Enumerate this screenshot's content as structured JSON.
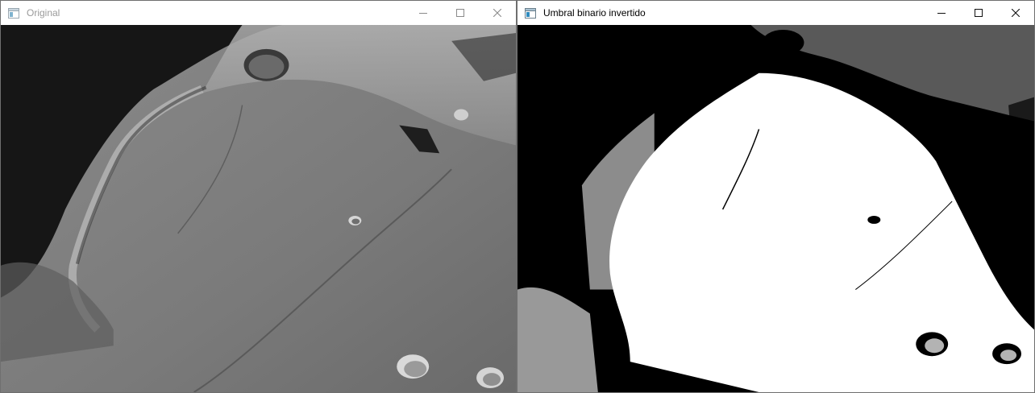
{
  "windows": {
    "original": {
      "title": "Original",
      "icon": "window-app-icon",
      "controls": [
        "minimize-icon",
        "maximize-icon",
        "close-icon"
      ]
    },
    "binary": {
      "title": "Umbral binario invertido",
      "icon": "window-app-icon",
      "controls": [
        "minimize-icon",
        "maximize-icon",
        "close-icon"
      ]
    }
  },
  "colors": {
    "titlebar_bg": "#ffffff",
    "inactive_title": "#9a9a9a",
    "active_title": "#000000",
    "moon_surface": "#7a7a7a",
    "sky": "#141414",
    "binary_white": "#ffffff",
    "binary_black": "#000000"
  }
}
